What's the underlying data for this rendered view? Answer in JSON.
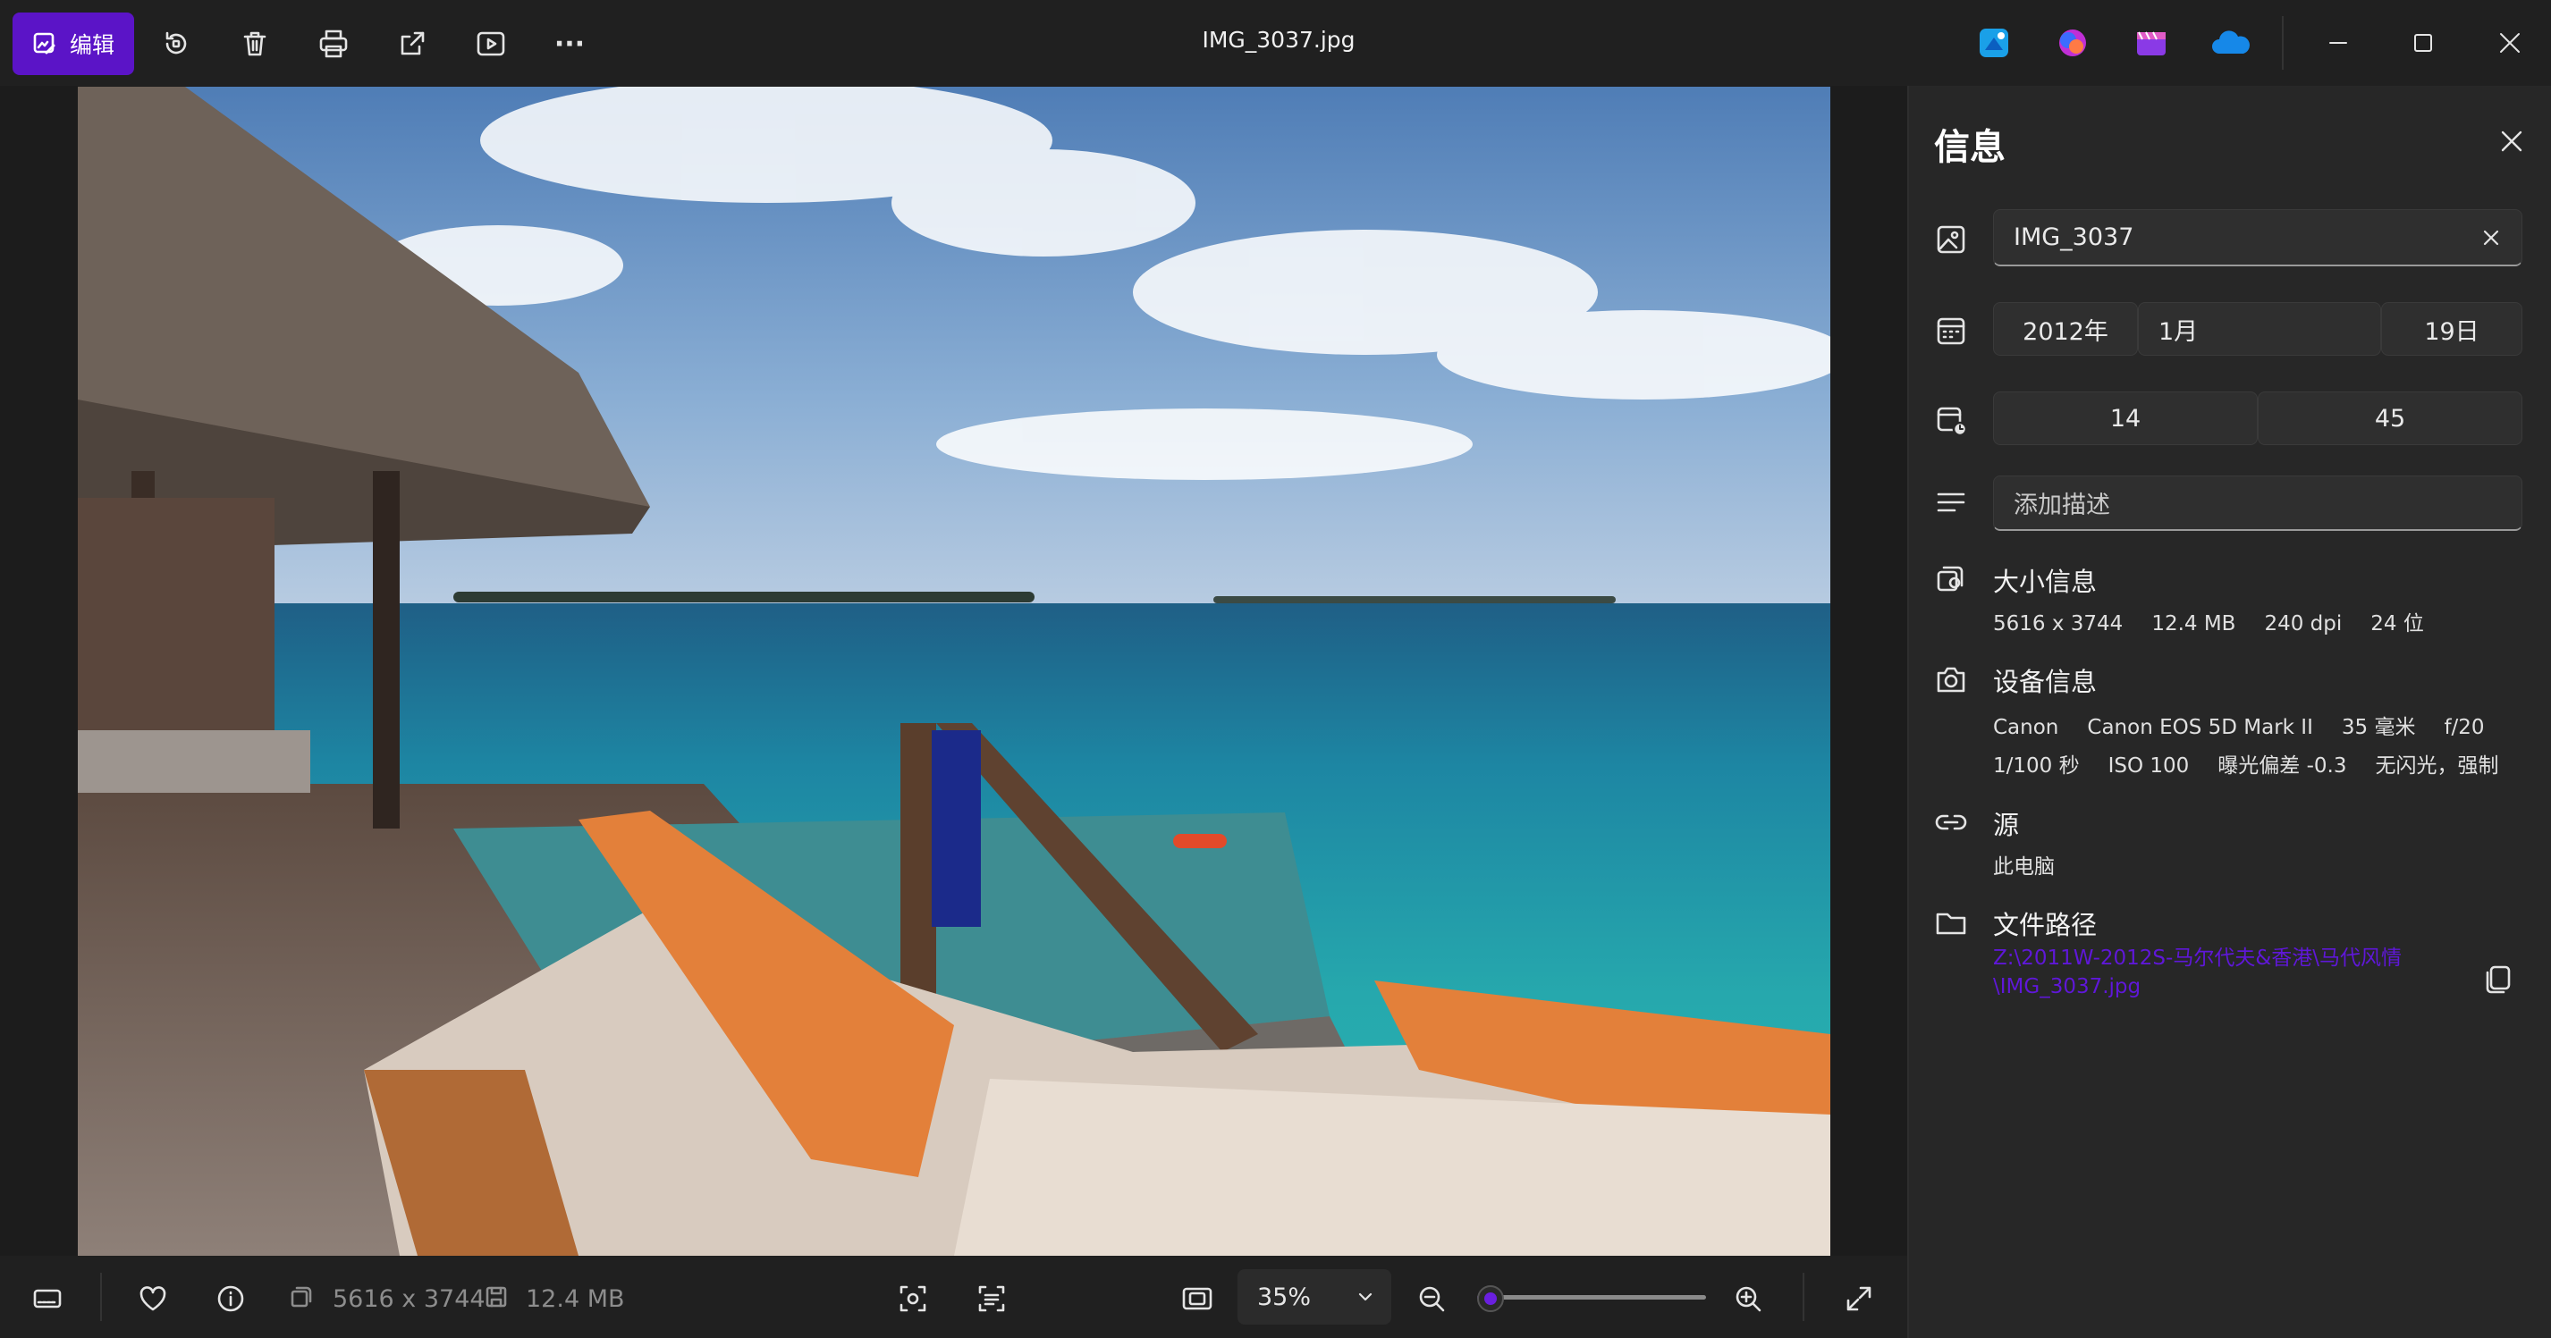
{
  "titlebar": {
    "edit_label": "编辑",
    "file_name": "IMG_3037.jpg",
    "more_label": "···"
  },
  "panel": {
    "title": "信息",
    "name_value": "IMG_3037",
    "date": {
      "year": "2012年",
      "month": "1月",
      "day": "19日"
    },
    "time": {
      "hour": "14",
      "minute": "45"
    },
    "description_placeholder": "添加描述",
    "size_section": {
      "title": "大小信息",
      "values": [
        "5616 x 3744",
        "12.4 MB",
        "240 dpi",
        "24 位"
      ]
    },
    "device_section": {
      "title": "设备信息",
      "line1": [
        "Canon",
        "Canon EOS 5D Mark II",
        "35 毫米",
        "f/20"
      ],
      "line2": [
        "1/100 秒",
        "ISO 100",
        "曝光偏差 -0.3",
        "无闪光，强制"
      ]
    },
    "source_section": {
      "title": "源",
      "value": "此电脑"
    },
    "path_section": {
      "title": "文件路径",
      "value": "Z:\\2011W-2012S-马尔代夫&香港\\马代风情\\IMG_3037.jpg"
    }
  },
  "bottombar": {
    "dimensions": "5616 x 3744",
    "filesize": "12.4 MB",
    "zoom": "35%",
    "zoom_slider_fraction": 0.06
  },
  "colors": {
    "accent": "#5b14c7",
    "path_link": "#5f17d8",
    "panel_bg": "#272727"
  }
}
